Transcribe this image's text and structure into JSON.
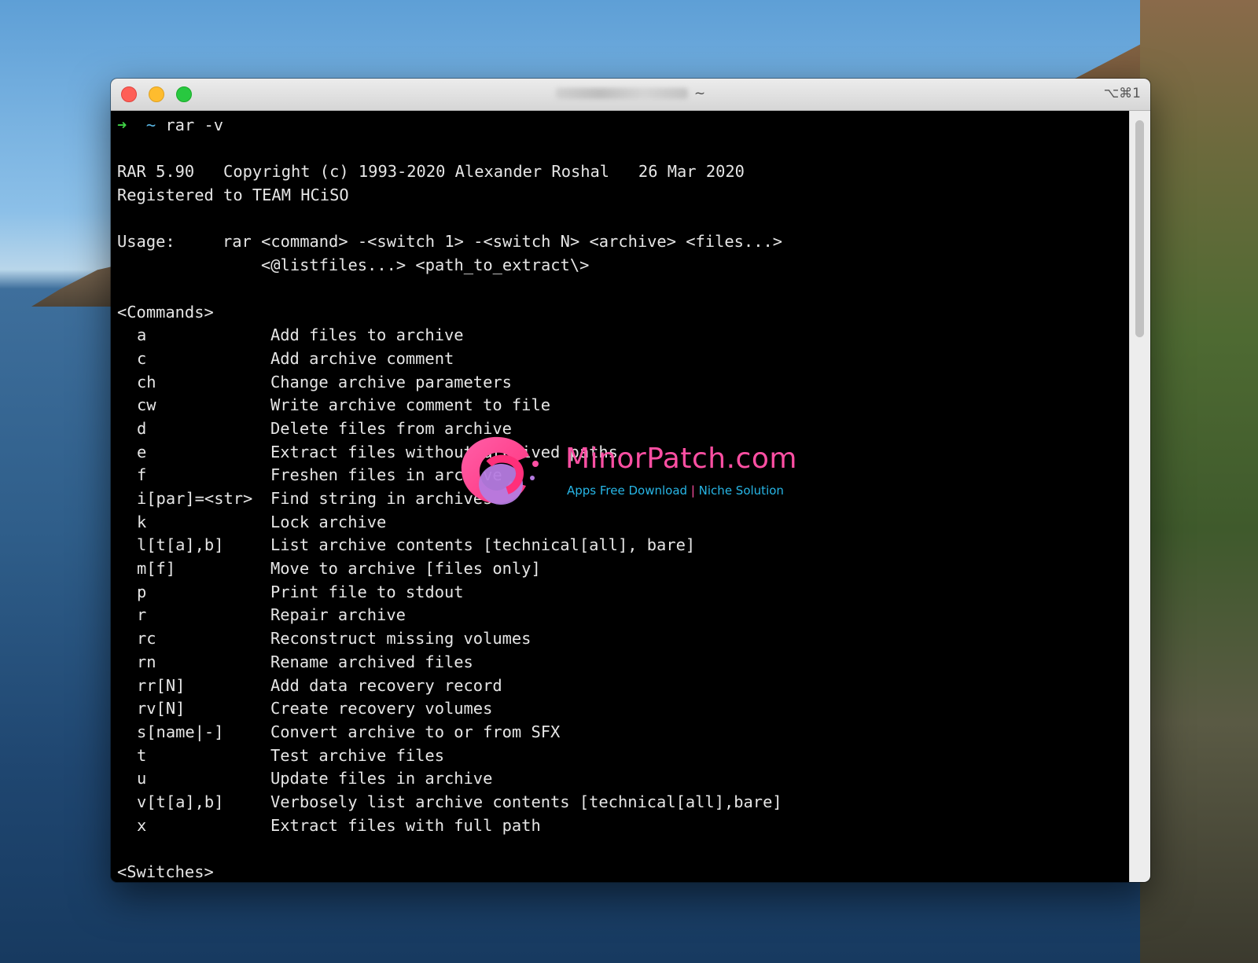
{
  "window": {
    "title_suffix": "~",
    "shortcut": "⌥⌘1"
  },
  "terminal": {
    "prompt": {
      "arrow": "➜",
      "tilde": "~",
      "command": "rar -v"
    },
    "header": {
      "line1": "RAR 5.90   Copyright (c) 1993-2020 Alexander Roshal   26 Mar 2020",
      "line2": "Registered to TEAM HCiSO"
    },
    "usage": {
      "label": "Usage:",
      "line1": "rar <command> -<switch 1> -<switch N> <archive> <files...>",
      "line2": "<@listfiles...> <path_to_extract\\>"
    },
    "commands_heading": "<Commands>",
    "commands": [
      {
        "key": "a",
        "desc": "Add files to archive"
      },
      {
        "key": "c",
        "desc": "Add archive comment"
      },
      {
        "key": "ch",
        "desc": "Change archive parameters"
      },
      {
        "key": "cw",
        "desc": "Write archive comment to file"
      },
      {
        "key": "d",
        "desc": "Delete files from archive"
      },
      {
        "key": "e",
        "desc": "Extract files without archived paths"
      },
      {
        "key": "f",
        "desc": "Freshen files in archive"
      },
      {
        "key": "i[par]=<str>",
        "desc": "Find string in archives"
      },
      {
        "key": "k",
        "desc": "Lock archive"
      },
      {
        "key": "l[t[a],b]",
        "desc": "List archive contents [technical[all], bare]"
      },
      {
        "key": "m[f]",
        "desc": "Move to archive [files only]"
      },
      {
        "key": "p",
        "desc": "Print file to stdout"
      },
      {
        "key": "r",
        "desc": "Repair archive"
      },
      {
        "key": "rc",
        "desc": "Reconstruct missing volumes"
      },
      {
        "key": "rn",
        "desc": "Rename archived files"
      },
      {
        "key": "rr[N]",
        "desc": "Add data recovery record"
      },
      {
        "key": "rv[N]",
        "desc": "Create recovery volumes"
      },
      {
        "key": "s[name|-]",
        "desc": "Convert archive to or from SFX"
      },
      {
        "key": "t",
        "desc": "Test archive files"
      },
      {
        "key": "u",
        "desc": "Update files in archive"
      },
      {
        "key": "v[t[a],b]",
        "desc": "Verbosely list archive contents [technical[all],bare]"
      },
      {
        "key": "x",
        "desc": "Extract files with full path"
      }
    ],
    "switches_heading": "<Switches>"
  },
  "watermark": {
    "brand": "MinorPatch.com",
    "tagline_left": "Apps Free Download",
    "separator": "|",
    "tagline_right": "Niche Solution"
  },
  "colors": {
    "prompt_arrow": "#3fd145",
    "prompt_tilde": "#5ab8e6",
    "terminal_bg": "#000000",
    "terminal_fg": "#e6e6e6",
    "close": "#fe5f57",
    "minimize": "#febc2e",
    "maximize": "#28c840",
    "watermark_pink": "#ff4fa3",
    "watermark_blue": "#27b6e6"
  }
}
